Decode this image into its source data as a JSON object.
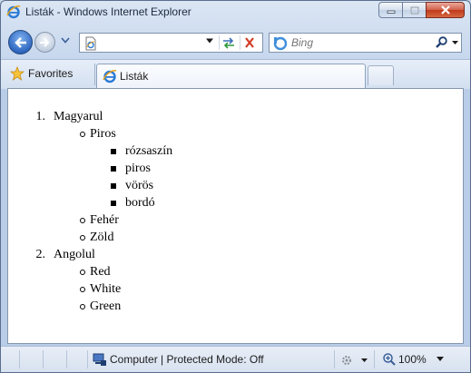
{
  "window": {
    "title": "Listák - Windows Internet Explorer"
  },
  "navigation": {
    "address_value": "",
    "search_placeholder": "Bing"
  },
  "favorites_bar": {
    "favorites_label": "Favorites"
  },
  "tabs": [
    {
      "label": "Listák",
      "active": true
    }
  ],
  "content": {
    "list": [
      {
        "number": "1.",
        "label": "Magyarul",
        "children": [
          {
            "label": "Piros",
            "children": [
              "rózsaszín",
              "piros",
              "vörös",
              "bordó"
            ]
          },
          {
            "label": "Fehér"
          },
          {
            "label": "Zöld"
          }
        ]
      },
      {
        "number": "2.",
        "label": "Angolul",
        "children": [
          {
            "label": "Red"
          },
          {
            "label": "White"
          },
          {
            "label": "Green"
          }
        ]
      }
    ]
  },
  "status_bar": {
    "zone_text": "Computer | Protected Mode: Off",
    "zoom": "100%"
  },
  "colors": {
    "close_button": "#c0391d",
    "frame": "#c8d8ee",
    "back_button": "#2f67c0"
  }
}
